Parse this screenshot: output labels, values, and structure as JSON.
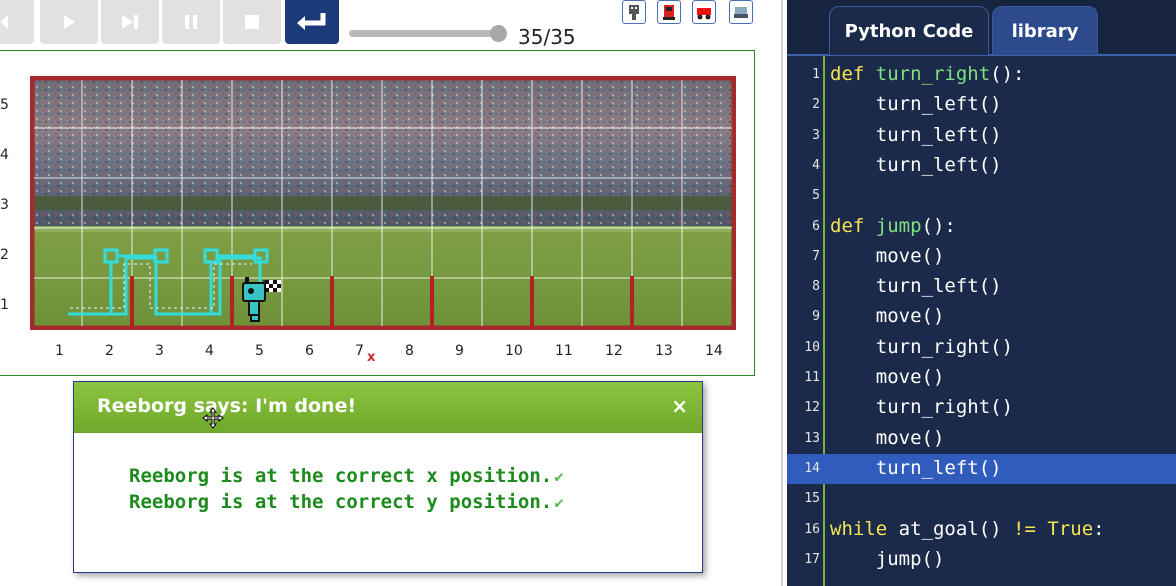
{
  "toolbar": {
    "buttons": [
      "reload-button",
      "run-button",
      "step-button",
      "pause-button",
      "stop-button",
      "return-button"
    ],
    "step_counter": "35/35",
    "progress": 1.0
  },
  "world": {
    "y_labels": [
      "5",
      "4",
      "3",
      "2",
      "1"
    ],
    "x_labels": [
      "1",
      "2",
      "3",
      "4",
      "5",
      "6",
      "7",
      "8",
      "9",
      "10",
      "11",
      "12",
      "13",
      "14"
    ],
    "goal_marker": "x",
    "background": "baseball stadium"
  },
  "dialog": {
    "title": "Reeborg says: I'm done!",
    "close": "×",
    "line1": "Reeborg is at the correct x position.",
    "line2": "Reeborg is at the correct y position."
  },
  "tabs": {
    "code": "Python Code",
    "library": "library"
  },
  "code": {
    "highlighted_line": 14,
    "lines": [
      {
        "n": "1",
        "text": "def turn_right():"
      },
      {
        "n": "2",
        "text": "    turn_left()"
      },
      {
        "n": "3",
        "text": "    turn_left()"
      },
      {
        "n": "4",
        "text": "    turn_left()"
      },
      {
        "n": "5",
        "text": ""
      },
      {
        "n": "6",
        "text": "def jump():"
      },
      {
        "n": "7",
        "text": "    move()"
      },
      {
        "n": "8",
        "text": "    turn_left()"
      },
      {
        "n": "9",
        "text": "    move()"
      },
      {
        "n": "10",
        "text": "    turn_right()"
      },
      {
        "n": "11",
        "text": "    move()"
      },
      {
        "n": "12",
        "text": "    turn_right()"
      },
      {
        "n": "13",
        "text": "    move()"
      },
      {
        "n": "14",
        "text": "    turn_left()"
      },
      {
        "n": "15",
        "text": ""
      },
      {
        "n": "16",
        "text": "while at_goal() != True:"
      },
      {
        "n": "17",
        "text": "    jump()"
      }
    ]
  },
  "colors": {
    "accent": "#1a3a7a",
    "dialog_green": "#7ab33a",
    "wall": "#b22222",
    "trail": "#33dddd"
  }
}
